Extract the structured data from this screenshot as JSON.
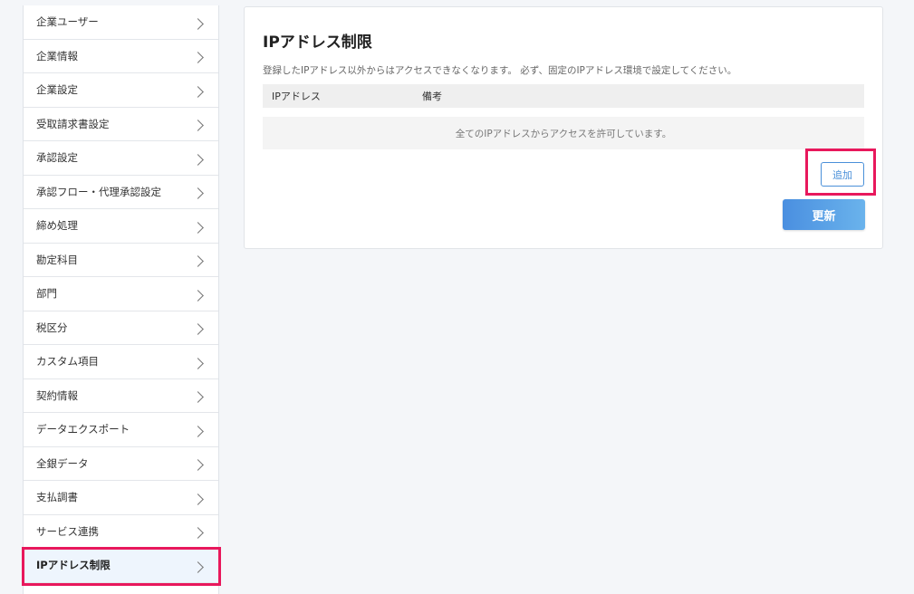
{
  "sidebar": {
    "items": [
      {
        "label": "企業ユーザー"
      },
      {
        "label": "企業情報"
      },
      {
        "label": "企業設定"
      },
      {
        "label": "受取請求書設定"
      },
      {
        "label": "承認設定"
      },
      {
        "label": "承認フロー・代理承認設定"
      },
      {
        "label": "締め処理"
      },
      {
        "label": "勘定科目"
      },
      {
        "label": "部門"
      },
      {
        "label": "税区分"
      },
      {
        "label": "カスタム項目"
      },
      {
        "label": "契約情報"
      },
      {
        "label": "データエクスポート"
      },
      {
        "label": "全銀データ"
      },
      {
        "label": "支払調書"
      },
      {
        "label": "サービス連携"
      },
      {
        "label": "IPアドレス制限"
      }
    ],
    "active_index": 16,
    "chevron_icon": "chevron-right-icon"
  },
  "main": {
    "title": "IPアドレス制限",
    "description": "登録したIPアドレス以外からはアクセスできなくなります。 必ず、固定のIPアドレス環境で設定してください。",
    "table": {
      "columns": [
        "IPアドレス",
        "備考"
      ],
      "empty_message": "全てのIPアドレスからアクセスを許可しています。"
    },
    "add_label": "追加",
    "update_label": "更新"
  },
  "colors": {
    "highlight": "#e8185c",
    "accent": "#4a90d9",
    "active_bg": "#eef5fd"
  }
}
